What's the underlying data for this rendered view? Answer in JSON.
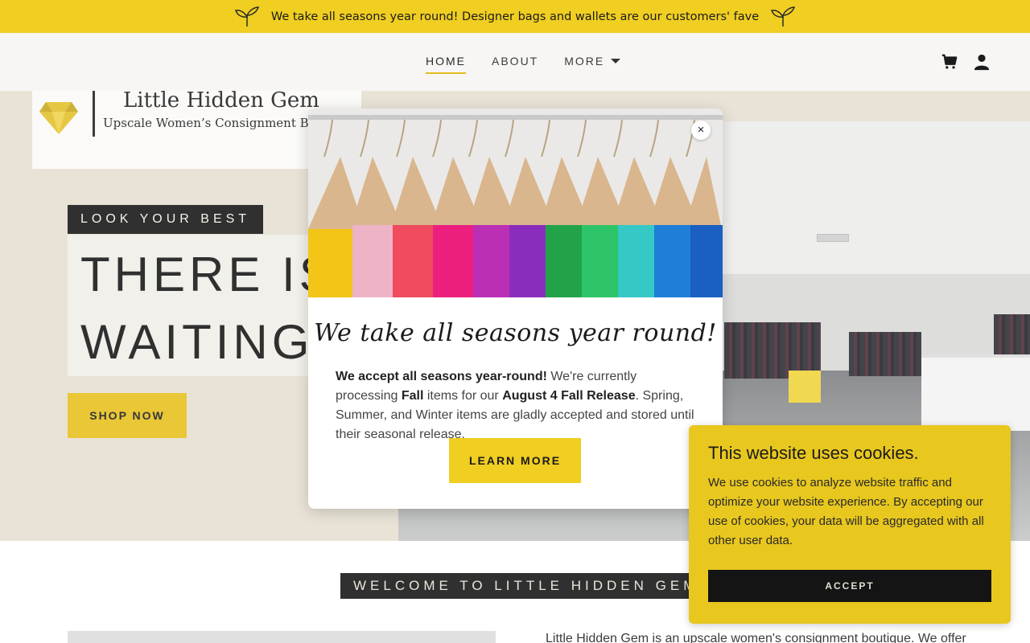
{
  "announcement": {
    "text": "We take all seasons year round! Designer bags and wallets are our customers' fave",
    "left_icon": "sprout-icon",
    "right_icon": "sprout-icon"
  },
  "header": {
    "nav": [
      {
        "label": "HOME",
        "active": true
      },
      {
        "label": "ABOUT",
        "active": false
      },
      {
        "label": "MORE",
        "active": false
      }
    ],
    "icons": [
      "cart-icon",
      "account-icon"
    ]
  },
  "hero": {
    "logo_title": "Little Hidden Gem",
    "logo_subtitle": "Upscale Women’s Consignment Boutique",
    "logo_icon": "diamond-icon",
    "tagline": "LOOK YOUR BEST",
    "headline_line1": "THERE IS",
    "headline_line2": "WAITING",
    "cta_label": "SHOP NOW"
  },
  "welcome": {
    "heading": "WELCOME TO LITTLE HIDDEN GEM",
    "intro": "Little Hidden Gem is an upscale women's consignment boutique. We offer"
  },
  "modal": {
    "image": "colorful-shirts-on-hangers",
    "title": "We take all seasons year round!",
    "body_bold1": "We accept all seasons year-round!",
    "body_text1": " We're currently processing ",
    "body_bold2": "Fall",
    "body_text2": " items for our ",
    "body_bold3": "August 4 Fall Release",
    "body_text3": ". Spring, Summer, and Winter items are gladly accepted and stored until their seasonal release.",
    "cta_label": "LEARN MORE",
    "close_label": "×"
  },
  "cookie": {
    "title": "This website uses cookies.",
    "body": "We use cookies to analyze website traffic and optimize your website experience. By accepting our use of cookies, your data will be aggregated with all other user data.",
    "accept_label": "ACCEPT"
  },
  "colors": {
    "accent": "#f0ce22",
    "dark": "#141414",
    "hero_bg": "#e6e0d2"
  }
}
